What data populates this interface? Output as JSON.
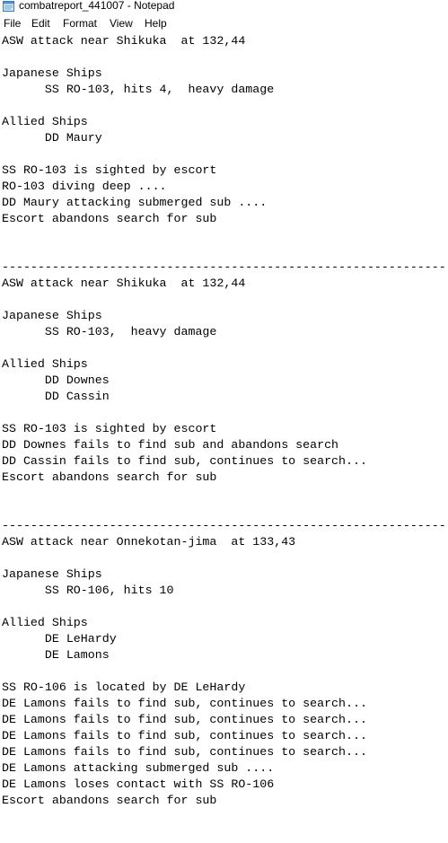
{
  "window": {
    "title": "combatreport_441007 - Notepad",
    "icon": "notepad-icon"
  },
  "menu": {
    "file": "File",
    "edit": "Edit",
    "format": "Format",
    "view": "View",
    "help": "Help"
  },
  "document": {
    "lines": [
      "ASW attack near Shikuka  at 132,44",
      "",
      "Japanese Ships",
      "      SS RO-103, hits 4,  heavy damage",
      "",
      "Allied Ships",
      "      DD Maury",
      "",
      "SS RO-103 is sighted by escort",
      "RO-103 diving deep ....",
      "DD Maury attacking submerged sub ....",
      "Escort abandons search for sub",
      "",
      "",
      "--------------------------------------------------------------",
      "ASW attack near Shikuka  at 132,44",
      "",
      "Japanese Ships",
      "      SS RO-103,  heavy damage",
      "",
      "Allied Ships",
      "      DD Downes",
      "      DD Cassin",
      "",
      "SS RO-103 is sighted by escort",
      "DD Downes fails to find sub and abandons search",
      "DD Cassin fails to find sub, continues to search...",
      "Escort abandons search for sub",
      "",
      "",
      "--------------------------------------------------------------",
      "ASW attack near Onnekotan-jima  at 133,43",
      "",
      "Japanese Ships",
      "      SS RO-106, hits 10",
      "",
      "Allied Ships",
      "      DE LeHardy",
      "      DE Lamons",
      "",
      "SS RO-106 is located by DE LeHardy",
      "DE Lamons fails to find sub, continues to search...",
      "DE Lamons fails to find sub, continues to search...",
      "DE Lamons fails to find sub, continues to search...",
      "DE Lamons fails to find sub, continues to search...",
      "DE Lamons attacking submerged sub ....",
      "DE Lamons loses contact with SS RO-106",
      "Escort abandons search for sub"
    ]
  }
}
